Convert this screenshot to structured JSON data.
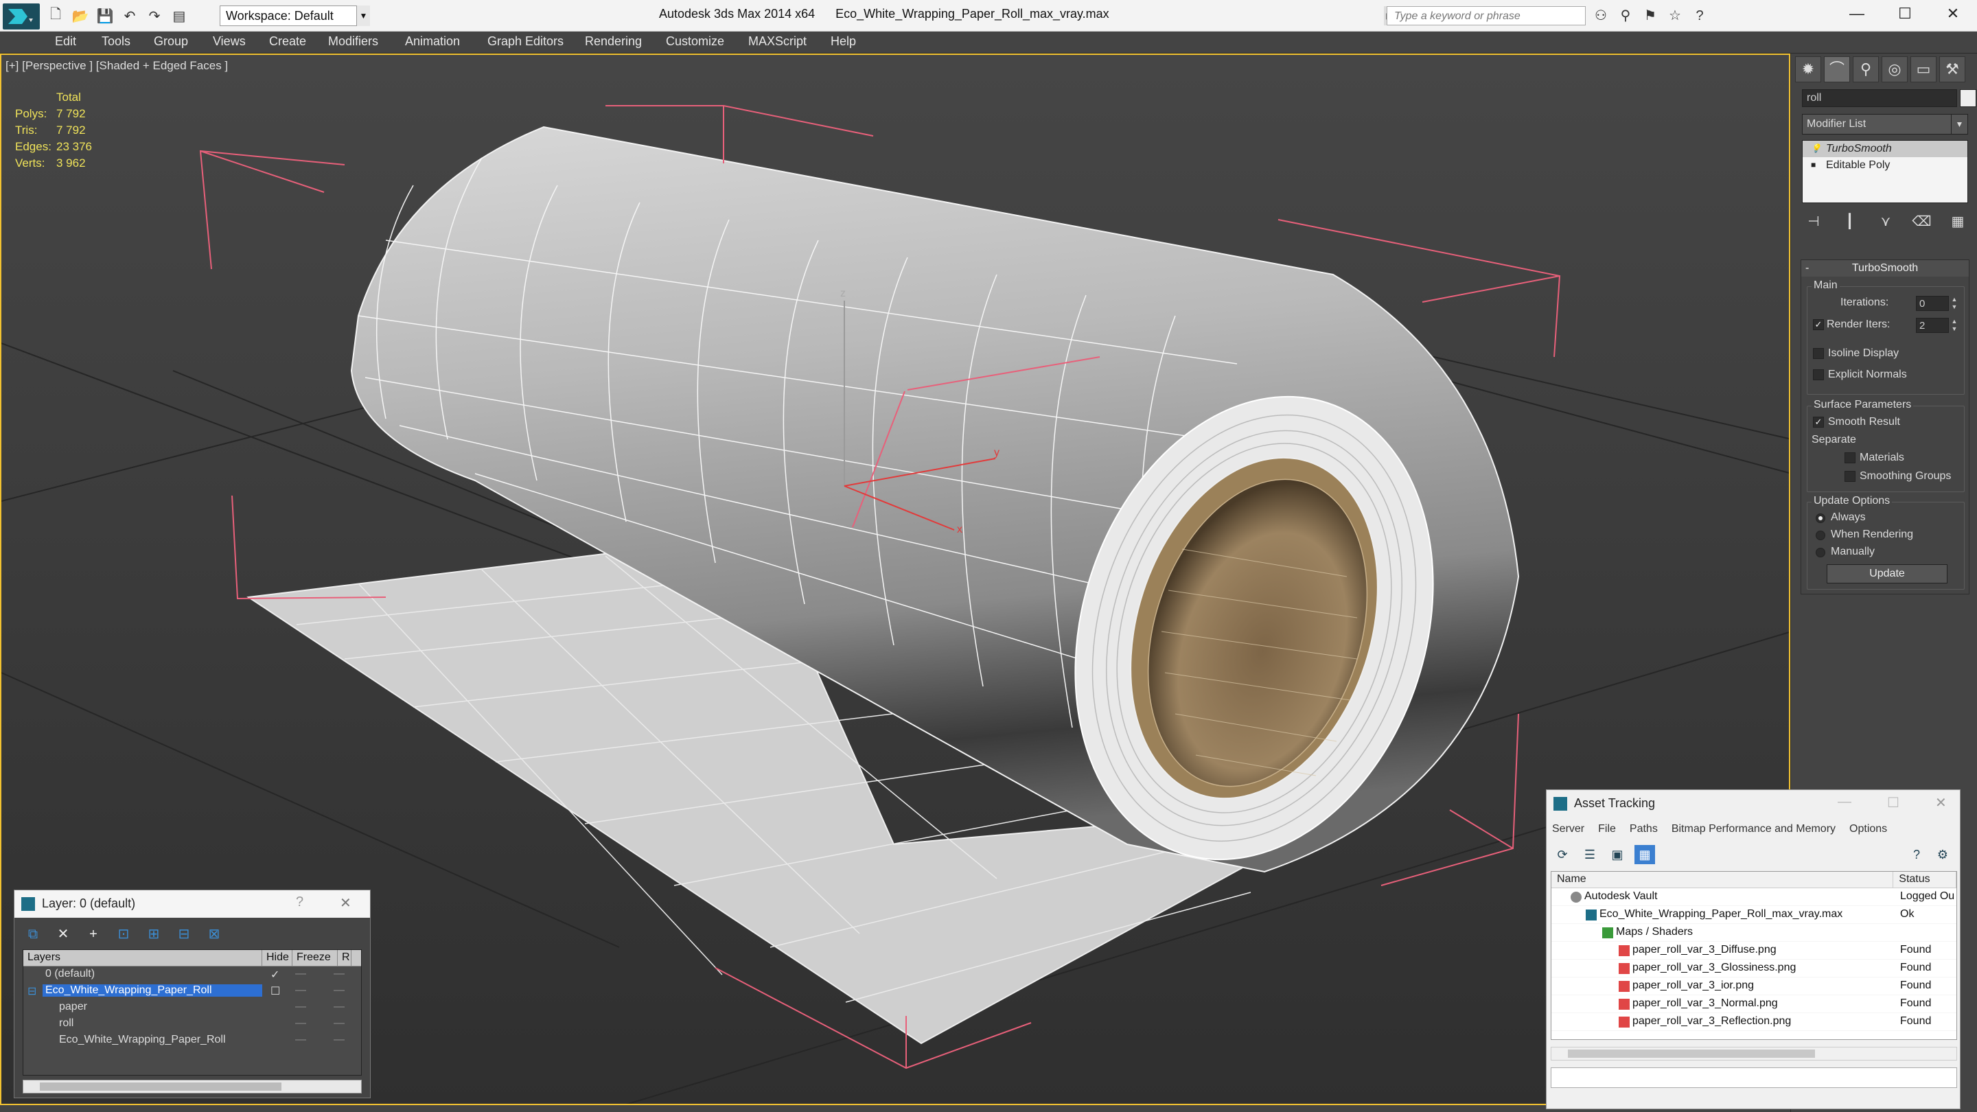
{
  "titlebar": {
    "workspace": "Workspace: Default",
    "app_title": "Autodesk 3ds Max 2014 x64      Eco_White_Wrapping_Paper_Roll_max_vray.max",
    "search_placeholder": "Type a keyword or phrase"
  },
  "menu": [
    "Edit",
    "Tools",
    "Group",
    "Views",
    "Create",
    "Modifiers",
    "Animation",
    "Graph Editors",
    "Rendering",
    "Customize",
    "MAXScript",
    "Help"
  ],
  "viewport": {
    "label": "[+] [Perspective ] [Shaded + Edged Faces ]",
    "stats": {
      "header": "Total",
      "polys_label": "Polys:",
      "polys": "7 792",
      "tris_label": "Tris:",
      "tris": "7 792",
      "edges_label": "Edges:",
      "edges": "23 376",
      "verts_label": "Verts:",
      "verts": "3 962"
    },
    "gizmo": {
      "z": "z",
      "y": "y",
      "x": "x"
    }
  },
  "command_panel": {
    "object_name": "roll",
    "modifier_list": "Modifier List",
    "stack": [
      "TurboSmooth",
      "Editable Poly"
    ],
    "rollout": {
      "title": "TurboSmooth",
      "main_group": "Main",
      "iterations_label": "Iterations:",
      "iterations": "0",
      "render_iters_label": "Render Iters:",
      "render_iters": "2",
      "isoline_display": "Isoline Display",
      "explicit_normals": "Explicit Normals",
      "surface_group": "Surface Parameters",
      "smooth_result": "Smooth Result",
      "separate": "Separate",
      "materials": "Materials",
      "smoothing_groups": "Smoothing Groups",
      "update_group": "Update Options",
      "always": "Always",
      "when_rendering": "When Rendering",
      "manually": "Manually",
      "update_button": "Update"
    }
  },
  "layer_window": {
    "title": "Layer: 0 (default)",
    "help": "?",
    "columns": [
      "Layers",
      "Hide",
      "Freeze",
      "R"
    ],
    "rows": [
      "0 (default)",
      "Eco_White_Wrapping_Paper_Roll",
      "paper",
      "roll",
      "Eco_White_Wrapping_Paper_Roll"
    ]
  },
  "asset_window": {
    "title": "Asset Tracking",
    "menu": [
      "Server",
      "File",
      "Paths",
      "Bitmap Performance and Memory",
      "Options"
    ],
    "columns": [
      "Name",
      "Status"
    ],
    "rows": [
      {
        "name": "Autodesk Vault",
        "status": "Logged Ou"
      },
      {
        "name": "Eco_White_Wrapping_Paper_Roll_max_vray.max",
        "status": "Ok"
      },
      {
        "name": "Maps / Shaders",
        "status": ""
      },
      {
        "name": "paper_roll_var_3_Diffuse.png",
        "status": "Found"
      },
      {
        "name": "paper_roll_var_3_Glossiness.png",
        "status": "Found"
      },
      {
        "name": "paper_roll_var_3_ior.png",
        "status": "Found"
      },
      {
        "name": "paper_roll_var_3_Normal.png",
        "status": "Found"
      },
      {
        "name": "paper_roll_var_3_Reflection.png",
        "status": "Found"
      }
    ]
  },
  "colors": {
    "selection_blue": "#2d6fd3",
    "viewport_border": "#f2c231",
    "stats_yellow": "#f0e35a",
    "paper_core": "#8c7352"
  }
}
